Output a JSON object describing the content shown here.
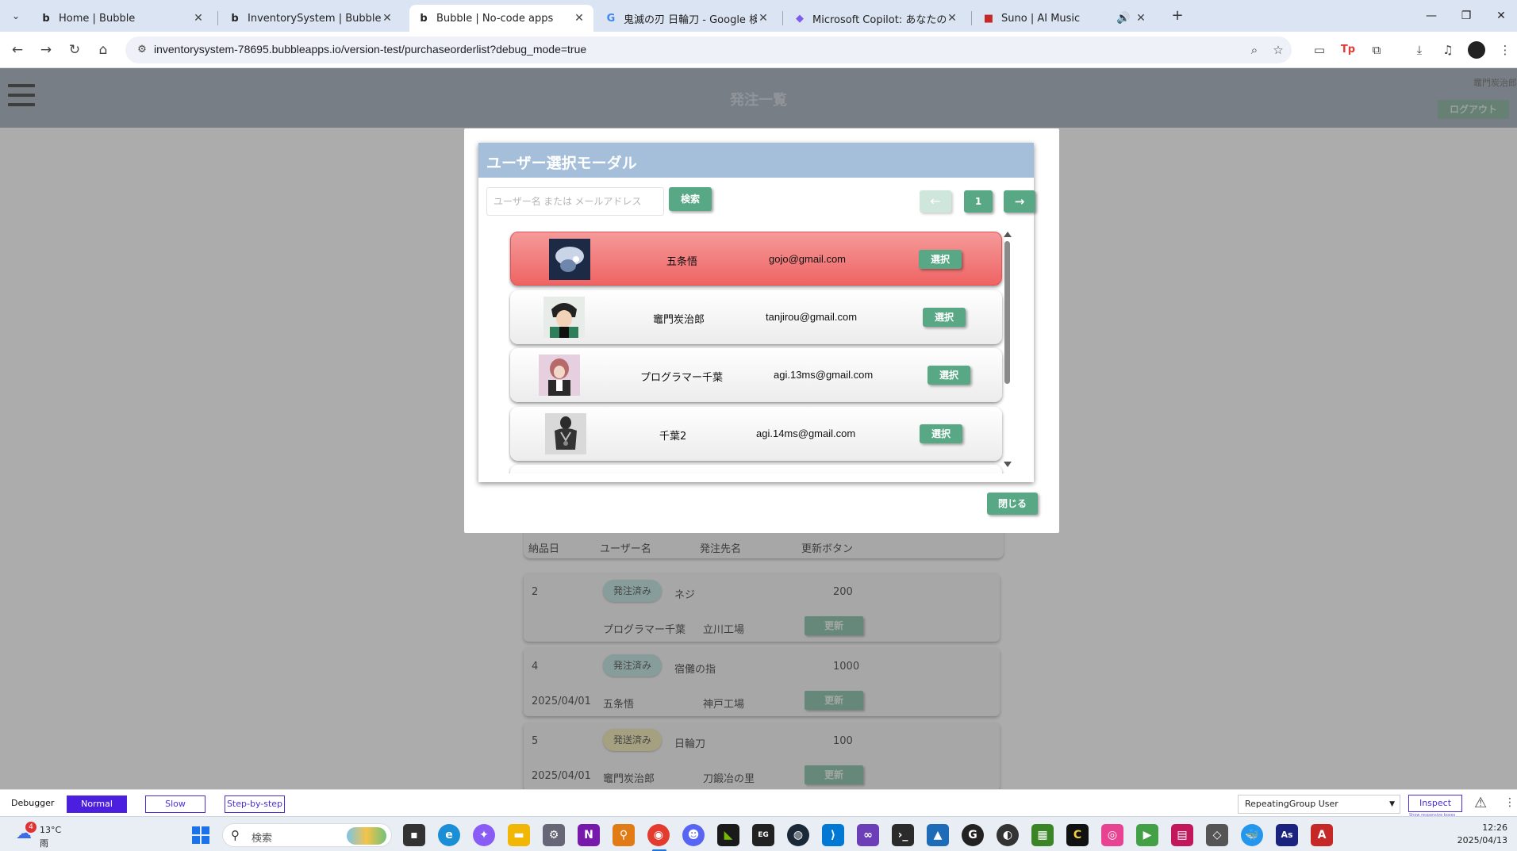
{
  "browser": {
    "tabs": [
      {
        "title": "Home | Bubble",
        "favicon": "b"
      },
      {
        "title": "InventorySystem | Bubble Editor",
        "favicon": "b"
      },
      {
        "title": "Bubble | No-code apps",
        "favicon": "b"
      },
      {
        "title": "鬼滅の刃 日輪刀 - Google 検索",
        "favicon": "G"
      },
      {
        "title": "Microsoft Copilot: あなたの AI アシスタント",
        "favicon": "C"
      },
      {
        "title": "Suno | AI Music",
        "favicon": "S"
      }
    ],
    "url": "inventorysystem-78695.bubbleapps.io/version-test/purchaseorderlist?debug_mode=true",
    "ext_tp": "Tp"
  },
  "app": {
    "page_title": "発注一覧",
    "user_name": "竈門炭治郎",
    "logout_label": "ログアウト"
  },
  "list": {
    "header": {
      "delivery_date": "納品日",
      "user_name": "ユーザー名",
      "supplier": "発注先名",
      "update_button": "更新ボタン"
    },
    "orders": [
      {
        "id": "2",
        "status": "発注済み",
        "item": "ネジ",
        "qty": "200",
        "delivery_date": "",
        "user": "プログラマー千葉",
        "supplier": "立川工場",
        "update": "更新"
      },
      {
        "id": "4",
        "status": "発注済み",
        "item": "宿儺の指",
        "qty": "1000",
        "delivery_date": "2025/04/01",
        "user": "五条悟",
        "supplier": "神戸工場",
        "update": "更新"
      },
      {
        "id": "5",
        "status": "発送済み",
        "item": "日輪刀",
        "qty": "100",
        "delivery_date": "2025/04/01",
        "user": "竈門炭治郎",
        "supplier": "刀鍛冶の里",
        "update": "更新"
      }
    ]
  },
  "modal": {
    "title": "ユーザー選択モーダル",
    "search_placeholder": "ユーザー名 または メールアドレス",
    "search_label": "検索",
    "prev_label": "←",
    "page_number": "1",
    "next_label": "→",
    "close_label": "閉じる",
    "users": [
      {
        "name": "五条悟",
        "email": "gojo@gmail.com",
        "select": "選択",
        "selected": true
      },
      {
        "name": "竈門炭治郎",
        "email": "tanjirou@gmail.com",
        "select": "選択",
        "selected": false
      },
      {
        "name": "プログラマー千葉",
        "email": "agi.13ms@gmail.com",
        "select": "選択",
        "selected": false
      },
      {
        "name": "千葉2",
        "email": "agi.14ms@gmail.com",
        "select": "選択",
        "selected": false
      }
    ]
  },
  "debugger": {
    "label": "Debugger",
    "modes": [
      "Normal",
      "Slow",
      "Step-by-step"
    ],
    "active_mode": "Normal",
    "element_select": "RepeatingGroup User",
    "inspect_label": "Inspect",
    "inspect_sub": "Show responsive boxes"
  },
  "taskbar": {
    "weather_temp": "13°C",
    "weather_cond": "雨",
    "weather_badge": "4",
    "search_text": "検索",
    "time": "12:26",
    "date": "2025/04/13"
  },
  "colors": {
    "accent_green": "#58a886",
    "selected_red": "#ef6464",
    "modal_header": "#a5bfda",
    "debugger_purple": "#4c1ee0"
  }
}
